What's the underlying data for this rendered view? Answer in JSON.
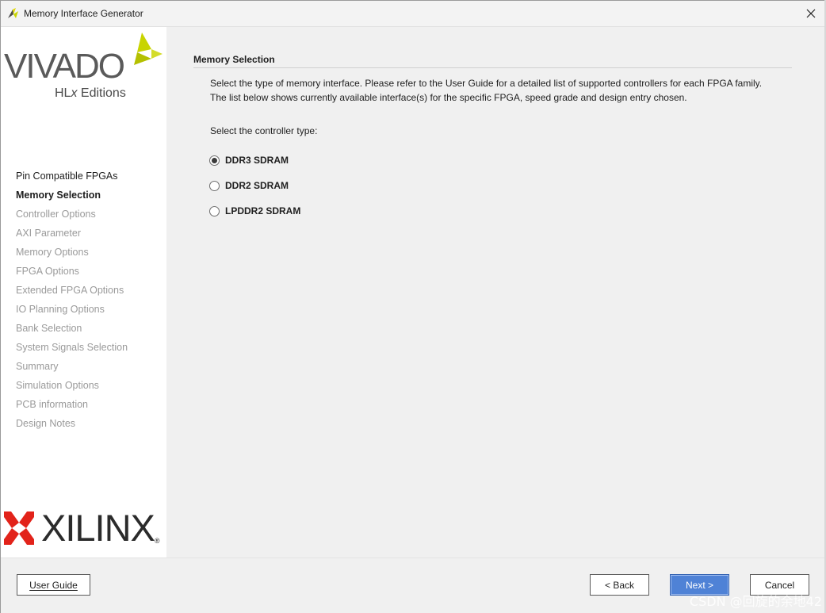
{
  "window": {
    "title": "Memory Interface Generator"
  },
  "sidebar": {
    "product": "VIVADO",
    "edition_prefix": "HL",
    "edition_x": "x",
    "edition_suffix": " Editions",
    "vendor": "XILINX",
    "steps": [
      {
        "label": "Pin Compatible FPGAs",
        "state": "done"
      },
      {
        "label": "Memory Selection",
        "state": "active"
      },
      {
        "label": "Controller Options",
        "state": "pending"
      },
      {
        "label": "AXI Parameter",
        "state": "pending"
      },
      {
        "label": "Memory Options",
        "state": "pending"
      },
      {
        "label": "FPGA Options",
        "state": "pending"
      },
      {
        "label": "Extended FPGA Options",
        "state": "pending"
      },
      {
        "label": "IO Planning Options",
        "state": "pending"
      },
      {
        "label": "Bank Selection",
        "state": "pending"
      },
      {
        "label": "System Signals Selection",
        "state": "pending"
      },
      {
        "label": "Summary",
        "state": "pending"
      },
      {
        "label": "Simulation Options",
        "state": "pending"
      },
      {
        "label": "PCB information",
        "state": "pending"
      },
      {
        "label": "Design Notes",
        "state": "pending"
      }
    ]
  },
  "main": {
    "section_title": "Memory Selection",
    "description_line1": "Select the type of memory interface. Please refer to the User Guide for a detailed list of supported controllers for each FPGA family.",
    "description_line2": "The list below shows currently available interface(s) for the specific FPGA, speed grade and design entry chosen.",
    "prompt": "Select the controller type:",
    "controller_options": [
      {
        "label": "DDR3 SDRAM",
        "selected": true
      },
      {
        "label": "DDR2 SDRAM",
        "selected": false
      },
      {
        "label": "LPDDR2 SDRAM",
        "selected": false
      }
    ]
  },
  "footer": {
    "user_guide_label": "User Guide",
    "back_label": "< Back",
    "next_label": "Next >",
    "cancel_label": "Cancel"
  },
  "watermark": "CSDN @回旋的余地42",
  "colors": {
    "primary_button": "#4f82d6",
    "vivado_leaf": "#c8d400",
    "xilinx_red": "#e2231a"
  }
}
